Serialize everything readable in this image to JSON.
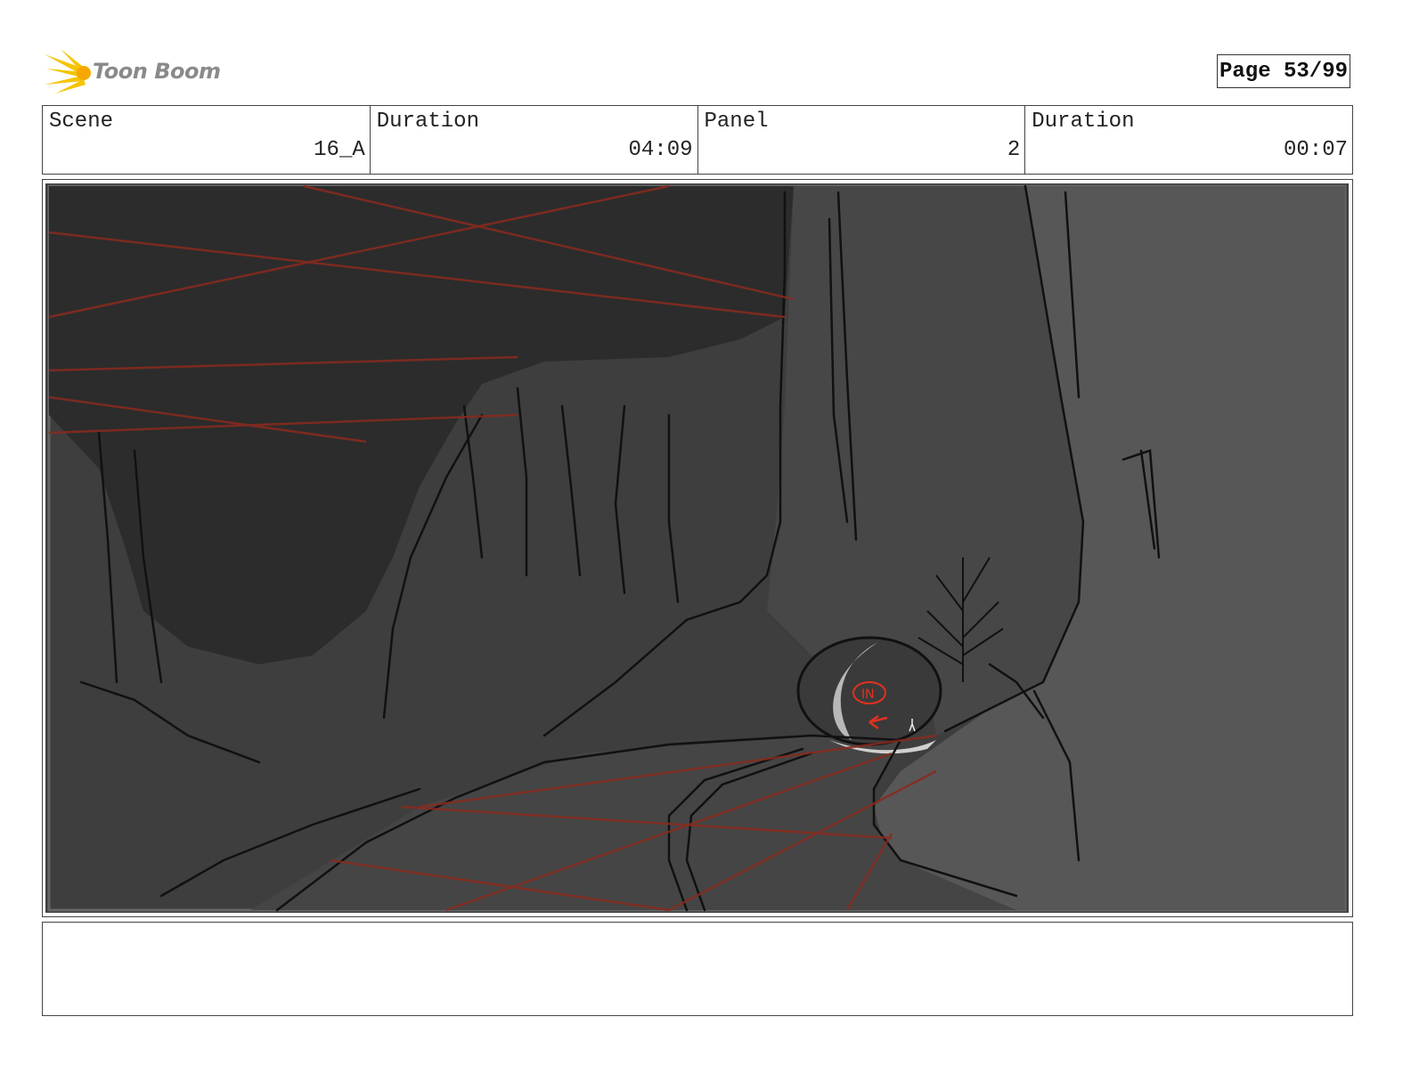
{
  "header": {
    "logo_text": "Toon Boom",
    "page_label": "Page 53/99"
  },
  "info": {
    "scene_label": "Scene",
    "scene_value": "16_A",
    "scene_duration_label": "Duration",
    "scene_duration_value": "04:09",
    "panel_label": "Panel",
    "panel_value": "2",
    "panel_duration_label": "Duration",
    "panel_duration_value": "00:07"
  },
  "panel": {
    "annotation_text": "IN"
  },
  "notes": {
    "text": ""
  }
}
